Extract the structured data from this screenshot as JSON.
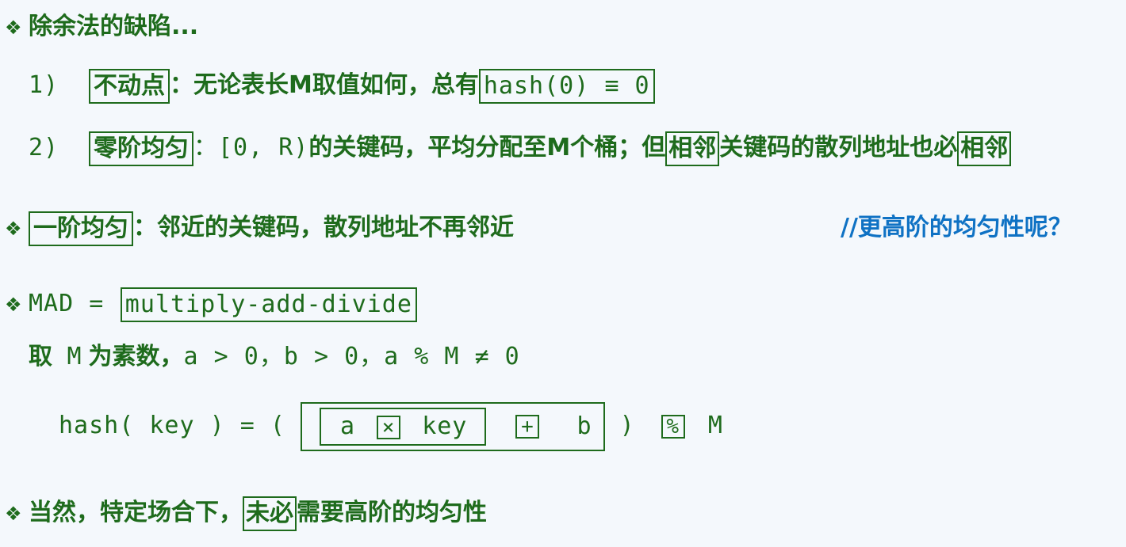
{
  "title": {
    "bullet": "❖",
    "text": "除余法的缺陷..."
  },
  "item1": {
    "num": "1)",
    "box": "不动点",
    "text": "：无论表长M取值如何，总有",
    "formula": "hash(0) ≡ 0"
  },
  "item2": {
    "num": "2)",
    "box": "零阶均匀",
    "range": "：[0, R)",
    "text_a": "的关键码，平均分配至M个桶；但",
    "box2": "相邻",
    "text_b": "关键码的散列地址也必",
    "box3": "相邻"
  },
  "first_order": {
    "bullet": "❖",
    "box": "一阶均匀",
    "text": "：邻近的关键码，散列地址不再邻近",
    "comment": "//更高阶的均匀性呢？"
  },
  "mad": {
    "bullet": "❖",
    "label": "MAD =",
    "box": "multiply-add-divide",
    "cond_a": "取",
    "cond_m": "M",
    "cond_b": "为素数，",
    "cond_c": "a > 0，b > 0，a % M ≠ 0",
    "formula": {
      "lhs": "hash( key ) = (",
      "a": "a",
      "times": "×",
      "key": "key",
      "plus": "+",
      "b": "b",
      "close": ")",
      "mod": "%",
      "m": "M"
    }
  },
  "footer": {
    "bullet": "❖",
    "text_a": "当然，特定场合下，",
    "box": "未必",
    "text_b": "需要高阶的均匀性"
  },
  "colors": {
    "text": "#1e6b1c",
    "comment": "#0f72c4",
    "background": "#f4f8fc"
  }
}
